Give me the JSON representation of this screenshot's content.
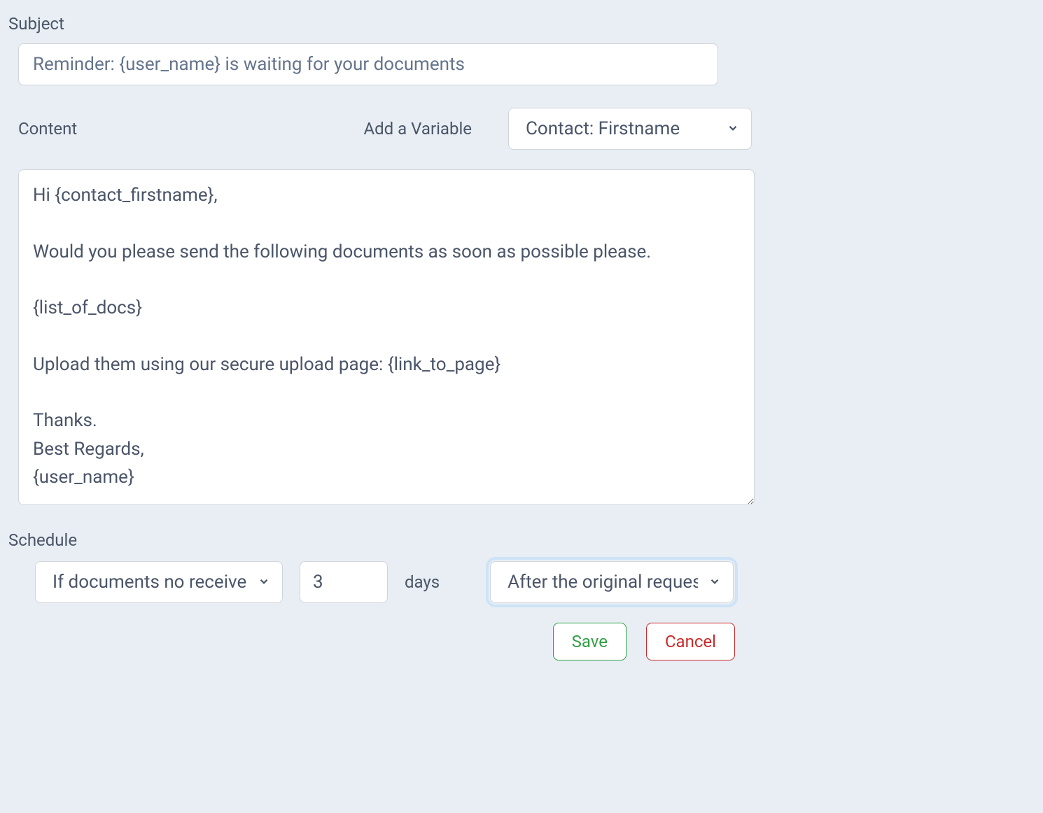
{
  "subject": {
    "label": "Subject",
    "value": "Reminder: {user_name} is waiting for your documents"
  },
  "content": {
    "label": "Content",
    "variable_label": "Add a Variable",
    "variable_selected": "Contact: Firstname",
    "body": "Hi {contact_firstname},\n\nWould you please send the following documents as soon as possible please.\n\n{list_of_docs}\n\nUpload them using our secure upload page: {link_to_page}\n\nThanks.\nBest Regards,\n{user_name}"
  },
  "schedule": {
    "label": "Schedule",
    "condition_selected": "If documents no received",
    "days_value": "3",
    "days_label": "days",
    "relative_selected": "After the original request"
  },
  "buttons": {
    "save": "Save",
    "cancel": "Cancel"
  }
}
